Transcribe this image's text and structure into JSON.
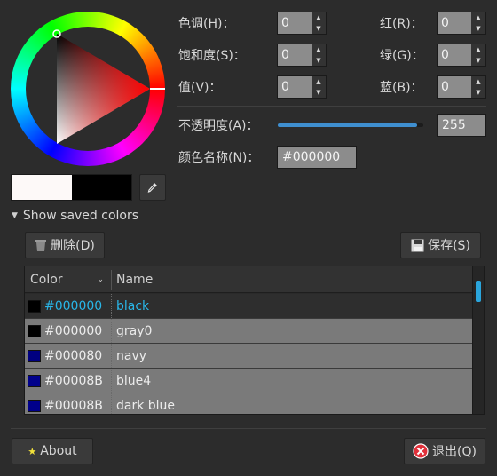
{
  "labels": {
    "hue": "色调(H)：",
    "hue_key": "H",
    "saturation": "饱和度(S)：",
    "value": "值(V)：",
    "red": "红(R)：",
    "green": "绿(G)：",
    "blue": "蓝(B)：",
    "opacity": "不透明度(A)：",
    "color_name": "颜色名称(N)："
  },
  "values": {
    "hue": "0",
    "saturation": "0",
    "value": "0",
    "red": "0",
    "green": "0",
    "blue": "0",
    "opacity": "255",
    "opacity_fraction": 0.96,
    "color_name": "#000000"
  },
  "saved": {
    "toggle_label": "Show saved colors",
    "delete_label": "删除(D)",
    "save_label": "保存(S)"
  },
  "table": {
    "headers": {
      "color": "Color",
      "name": "Name"
    },
    "rows": [
      {
        "hex": "#000000",
        "name": "black",
        "swatch": "#000000",
        "selected": true
      },
      {
        "hex": "#000000",
        "name": "gray0",
        "swatch": "#000000",
        "selected": false
      },
      {
        "hex": "#000080",
        "name": "navy",
        "swatch": "#000080",
        "selected": false
      },
      {
        "hex": "#00008B",
        "name": "blue4",
        "swatch": "#00008B",
        "selected": false
      },
      {
        "hex": "#00008B",
        "name": "dark blue",
        "swatch": "#00008B",
        "selected": false
      }
    ]
  },
  "footer": {
    "about_label": "About",
    "quit_label": "退出(Q)"
  },
  "colors": {
    "accent": "#29b6e8",
    "quit_icon": "#e0303a",
    "about_star": "#f2e13a"
  }
}
